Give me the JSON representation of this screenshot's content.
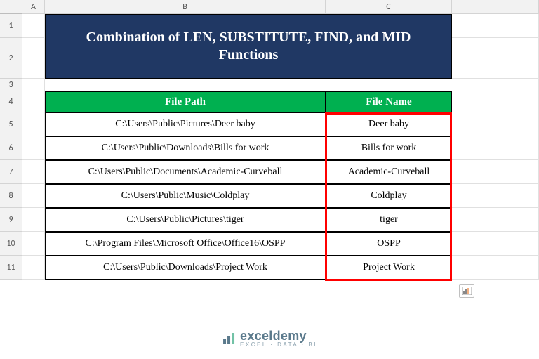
{
  "columns": [
    "A",
    "B",
    "C"
  ],
  "rows": [
    "1",
    "2",
    "3",
    "4",
    "5",
    "6",
    "7",
    "8",
    "9",
    "10",
    "11"
  ],
  "title": "Combination of LEN, SUBSTITUTE, FIND, and MID Functions",
  "headers": {
    "path": "File Path",
    "name": "File Name"
  },
  "data": [
    {
      "path": "C:\\Users\\Public\\Pictures\\Deer baby",
      "name": "Deer baby"
    },
    {
      "path": "C:\\Users\\Public\\Downloads\\Bills for work",
      "name": "Bills for work"
    },
    {
      "path": "C:\\Users\\Public\\Documents\\Academic-Curveball",
      "name": "Academic-Curveball"
    },
    {
      "path": "C:\\Users\\Public\\Music\\Coldplay",
      "name": "Coldplay"
    },
    {
      "path": "C:\\Users\\Public\\Pictures\\tiger",
      "name": "tiger"
    },
    {
      "path": "C:\\Program Files\\Microsoft Office\\Office16\\OSPP",
      "name": "OSPP"
    },
    {
      "path": "C:\\Users\\Public\\Downloads\\Project Work",
      "name": "Project Work"
    }
  ],
  "logo": {
    "main": "exceldemy",
    "sub": "EXCEL · DATA · BI"
  },
  "chart_data": {
    "type": "table",
    "title": "Combination of LEN, SUBSTITUTE, FIND, and MID Functions",
    "columns": [
      "File Path",
      "File Name"
    ],
    "rows": [
      [
        "C:\\Users\\Public\\Pictures\\Deer baby",
        "Deer baby"
      ],
      [
        "C:\\Users\\Public\\Downloads\\Bills for work",
        "Bills for work"
      ],
      [
        "C:\\Users\\Public\\Documents\\Academic-Curveball",
        "Academic-Curveball"
      ],
      [
        "C:\\Users\\Public\\Music\\Coldplay",
        "Coldplay"
      ],
      [
        "C:\\Users\\Public\\Pictures\\tiger",
        "tiger"
      ],
      [
        "C:\\Program Files\\Microsoft Office\\Office16\\OSPP",
        "OSPP"
      ],
      [
        "C:\\Users\\Public\\Downloads\\Project Work",
        "Project Work"
      ]
    ]
  }
}
